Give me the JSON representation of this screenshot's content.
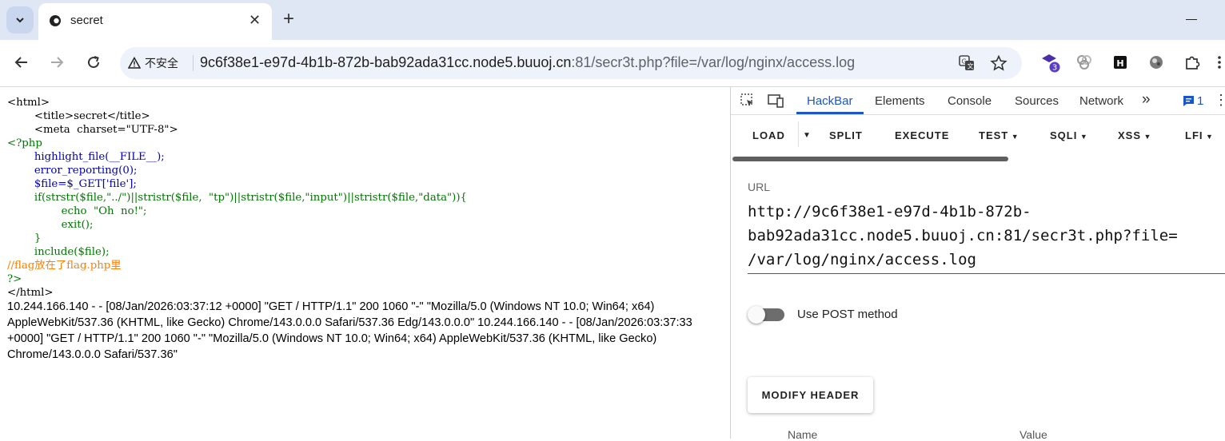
{
  "tab": {
    "title": "secret"
  },
  "address_bar": {
    "security_label": "不安全",
    "url_host": "9c6f38e1-e97d-4b1b-872b-bab92ada31cc.node5.buuoj.cn",
    "url_rest": ":81/secr3t.php?file=/var/log/nginx/access.log"
  },
  "extensions": {
    "badge_count": "3"
  },
  "page": {
    "source": {
      "l1": "<html>",
      "l2": "        <title>secret</title>",
      "l3": "        <meta  charset=\"UTF-8\">",
      "l4": "<?php",
      "l5": "        highlight_file(__FILE__);",
      "l6": "        error_reporting(0);",
      "l7": "        $file=$_GET['file'];",
      "l8": "        if(strstr($file,\"../\")||stristr($file,  \"tp\")||stristr($file,\"input\")||stristr($file,\"data\")){",
      "l9": "                echo  \"Oh  no!\";",
      "l10": "                exit();",
      "l11": "        }",
      "l12": "        include($file);",
      "l13": "//flag放在了flag.php里",
      "l14": "?>",
      "l15": "</html>"
    },
    "log": "10.244.166.140 - - [08/Jan/2026:03:37:12 +0000] \"GET / HTTP/1.1\" 200 1060 \"-\" \"Mozilla/5.0 (Windows NT 10.0; Win64; x64) AppleWebKit/537.36 (KHTML, like Gecko) Chrome/143.0.0.0 Safari/537.36 Edg/143.0.0.0\" 10.244.166.140 - - [08/Jan/2026:03:37:33 +0000] \"GET / HTTP/1.1\" 200 1060 \"-\" \"Mozilla/5.0 (Windows NT 10.0; Win64; x64) AppleWebKit/537.36 (KHTML, like Gecko) Chrome/143.0.0.0 Safari/537.36\""
  },
  "devtools": {
    "tabs": [
      "HackBar",
      "Elements",
      "Console",
      "Sources",
      "Network"
    ],
    "issues_count": "1",
    "hackbar": {
      "menu": {
        "load": "LOAD",
        "split": "SPLIT",
        "execute": "EXECUTE",
        "test": "TEST",
        "sqli": "SQLI",
        "xss": "XSS",
        "lfi": "LFI"
      },
      "url_label": "URL",
      "url_lines": [
        "http://9c6f38e1-e97d-4b1b-872b-",
        "bab92ada31cc.node5.buuoj.cn:81/secr3t.php?file=",
        "/var/log/nginx/access.log"
      ],
      "post_label": "Use POST method",
      "post_enabled": false,
      "modify_header": "MODIFY HEADER",
      "header_columns": {
        "name": "Name",
        "value": "Value"
      }
    }
  }
}
